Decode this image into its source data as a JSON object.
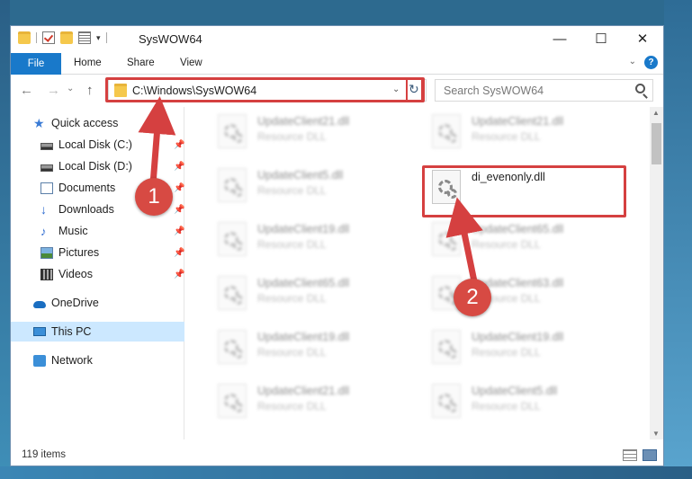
{
  "window": {
    "title": "SysWOW64",
    "minimize_glyph": "—",
    "maximize_glyph": "☐",
    "close_glyph": "✕"
  },
  "ribbon": {
    "file_tab": "File",
    "tabs": [
      "Home",
      "Share",
      "View"
    ],
    "help_glyph": "?"
  },
  "navigation": {
    "back_glyph": "←",
    "forward_glyph": "→",
    "recent_glyph": "⌄",
    "up_glyph": "↑",
    "address_path": "C:\\Windows\\SysWOW64",
    "address_dropdown_glyph": "⌄",
    "refresh_glyph": "↻",
    "search_placeholder": "Search SysWOW64"
  },
  "sidebar": {
    "items": [
      {
        "label": "Quick access",
        "icon": "star-icon",
        "pinned": false
      },
      {
        "label": "Local Disk (C:)",
        "icon": "drive-icon",
        "pinned": true
      },
      {
        "label": "Local Disk (D:)",
        "icon": "drive-icon",
        "pinned": true
      },
      {
        "label": "Documents",
        "icon": "documents-icon",
        "pinned": true
      },
      {
        "label": "Downloads",
        "icon": "download-icon",
        "pinned": true
      },
      {
        "label": "Music",
        "icon": "music-icon",
        "pinned": true
      },
      {
        "label": "Pictures",
        "icon": "pictures-icon",
        "pinned": true
      },
      {
        "label": "Videos",
        "icon": "videos-icon",
        "pinned": true
      },
      {
        "label": "OneDrive",
        "icon": "cloud-icon",
        "pinned": false
      },
      {
        "label": "This PC",
        "icon": "computer-icon",
        "pinned": false,
        "selected": true
      },
      {
        "label": "Network",
        "icon": "network-icon",
        "pinned": false
      }
    ],
    "pin_glyph": "📌"
  },
  "files": {
    "left_column": [
      {
        "name": "UpdateClient21.dll",
        "type": "Resource DLL"
      },
      {
        "name": "UpdateClient5.dll",
        "type": "Resource DLL"
      },
      {
        "name": "UpdateClient19.dll",
        "type": "Resource DLL"
      },
      {
        "name": "UpdateClient65.dll",
        "type": "Resource DLL"
      },
      {
        "name": "UpdateClient19.dll",
        "type": "Resource DLL"
      },
      {
        "name": "UpdateClient21.dll",
        "type": "Resource DLL"
      }
    ],
    "right_column": [
      {
        "name": "UpdateClient21.dll",
        "type": "Resource DLL"
      },
      {
        "name": "di_evenonly.dll",
        "type": "",
        "highlighted": true
      },
      {
        "name": "UpdateClient65.dll",
        "type": "Resource DLL"
      },
      {
        "name": "UpdateClient63.dll",
        "type": "Resource DLL"
      },
      {
        "name": "UpdateClient19.dll",
        "type": "Resource DLL"
      },
      {
        "name": "UpdateClient5.dll",
        "type": "Resource DLL"
      }
    ]
  },
  "status": {
    "item_count": "119 items"
  },
  "annotations": {
    "callout_1": "1",
    "callout_2": "2",
    "highlight_color": "#d54040"
  }
}
